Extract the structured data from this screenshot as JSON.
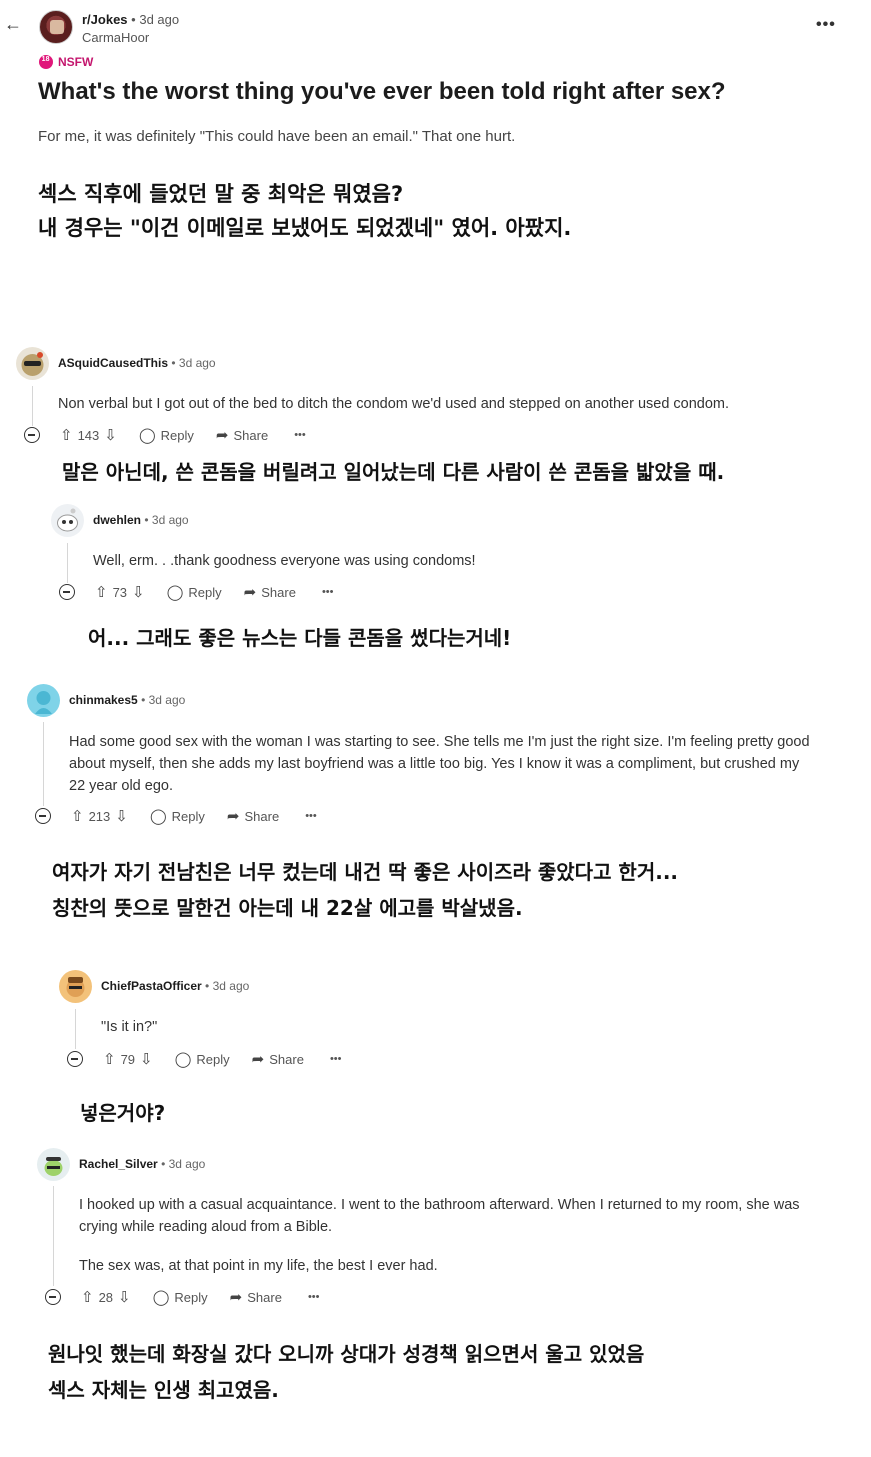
{
  "header": {
    "back_icon": "arrow-left-icon",
    "subreddit": "r/Jokes",
    "age": "• 3d ago",
    "username": "CarmaHoor",
    "more": "•••",
    "nsfw_label": "NSFW",
    "nsfw_badge": "18"
  },
  "post": {
    "title": "What's the worst thing you've ever been told right after sex?",
    "body": "For me, it was definitely \"This could have been an email.\" That one hurt.",
    "translation_line1": "섹스 직후에 들었던 말 중 최악은 뭐였음?",
    "translation_line2": "내 경우는 \"이건 이메일로 보냈어도 되었겠네\" 였어. 아팠지."
  },
  "actions": {
    "reply": "Reply",
    "share": "Share",
    "more": "•••"
  },
  "comments": [
    {
      "author": "ASquidCausedThis",
      "age": "• 3d ago",
      "text": "Non verbal but I got out of the bed to ditch the condom we'd used and stepped on another used condom.",
      "votes": "143",
      "translation": "말은 아닌데, 쓴 콘돔을 버릴려고 일어났는데 다른 사람이 쓴 콘돔을 밟았을 때."
    },
    {
      "author": "dwehlen",
      "age": "• 3d ago",
      "text": "Well, erm. . .thank goodness everyone was using condoms!",
      "votes": "73",
      "translation": "어... 그래도 좋은 뉴스는 다들 콘돔을 썼다는거네!"
    },
    {
      "author": "chinmakes5",
      "age": "• 3d ago",
      "text": "Had some good sex with the woman I was starting to see. She tells me I'm just the right size. I'm feeling pretty good about myself, then she adds my last boyfriend was a little too big. Yes I know it was a compliment, but crushed my 22 year old ego.",
      "votes": "213",
      "translation_line1": "여자가 자기 전남친은 너무 컸는데 내건 딱 좋은 사이즈라 좋았다고 한거...",
      "translation_line2": "칭찬의 뜻으로 말한건 아는데 내 22살 에고를 박살냈음."
    },
    {
      "author": "ChiefPastaOfficer",
      "age": "• 3d ago",
      "text": "\"Is it in?\"",
      "votes": "79",
      "translation": "넣은거야?"
    },
    {
      "author": "Rachel_Silver",
      "age": "• 3d ago",
      "text": "I hooked up with a casual acquaintance. I went to the bathroom afterward. When I returned to my room, she was crying while reading aloud from a Bible.",
      "text2": "The sex was, at that point in my life, the best I ever had.",
      "votes": "28",
      "translation_line1": "원나잇 했는데 화장실 갔다 오니까 상대가 성경책 읽으면서 울고 있었음",
      "translation_line2": "섹스 자체는 인생 최고였음."
    }
  ]
}
